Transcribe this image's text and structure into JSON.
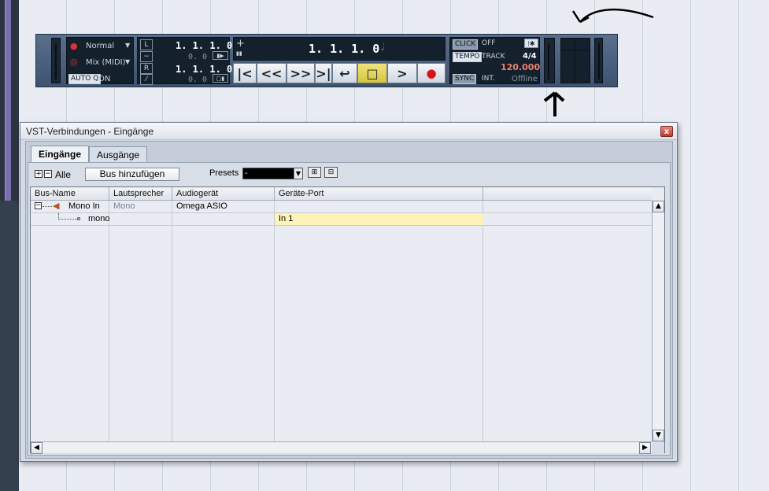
{
  "transport": {
    "precount_mode": "Normal",
    "record_mode": "Mix (MIDI)",
    "auto_q_label": "AUTO Q",
    "auto_q_value": "ON",
    "left_locator": "1. 1. 1.   0",
    "left_sub": "0.   0",
    "right_locator": "1. 1. 1.   0",
    "right_sub": "0.   0",
    "left_marker_label": "L",
    "right_marker_label": "R",
    "position_plus": "+",
    "position_main": "1. 1. 1.   0",
    "click_label": "CLICK",
    "click_value": "OFF",
    "tempo_label": "TEMPO",
    "tempo_mode": "TRACK",
    "signature": "4/4",
    "tempo_value": "120.000",
    "sync_label": "SYNC",
    "sync_source": "INT.",
    "sync_status": "Offline"
  },
  "dialog": {
    "title": "VST-Verbindungen - Eingänge",
    "close_glyph": "x",
    "tabs": [
      {
        "label": "Eingänge",
        "active": true
      },
      {
        "label": "Ausgänge",
        "active": false
      }
    ],
    "expand_all_label": "Alle",
    "add_bus_label": "Bus hinzufügen",
    "presets_label": "Presets",
    "presets_value": "-",
    "columns": [
      "Bus-Name",
      "Lautsprecher",
      "Audiogerät",
      "Geräte-Port"
    ],
    "rows": [
      {
        "bus_name": "Mono In",
        "speaker": "Mono",
        "device": "Omega ASIO",
        "port": ""
      },
      {
        "bus_name": "mono",
        "speaker": "",
        "device": "",
        "port": "In 1"
      }
    ]
  }
}
